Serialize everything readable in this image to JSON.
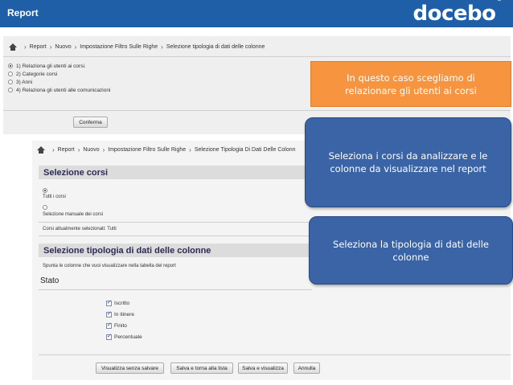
{
  "header": {
    "title": "Report",
    "logo": "docebo",
    "logo_mark": "®"
  },
  "breadcrumb1": {
    "home_icon": "home-icon",
    "items": [
      "Report",
      "Nuovo",
      "Impostazione Filtro Sulle Righe",
      "Selezione tipologia di dati delle colonne"
    ]
  },
  "options": [
    {
      "label": "1) Relaziona gli utenti ai corsi.",
      "selected": true
    },
    {
      "label": "2) Categorie corsi",
      "selected": false
    },
    {
      "label": "3) Anni",
      "selected": false
    },
    {
      "label": "4) Relaziona gli utenti alle comunicazioni",
      "selected": false
    }
  ],
  "confirm_label": "Conferma",
  "breadcrumb2": {
    "items": [
      "Report",
      "Nuovo",
      "Impostazione Filtro Sulle Righe",
      "Selezione Tipologia Di Dati Delle Colonn"
    ]
  },
  "courses_section": {
    "title": "Selezione corsi",
    "opt_all": "Tutti i corsi",
    "opt_manual": "Selezione manuale dei corsi",
    "selected_text": "Corsi attualmente selezionati:  Tutti"
  },
  "columns_section": {
    "title": "Selezione tipologia di dati delle colonne",
    "hint": "Spunta le colonne che vuoi visualizzare nella tabella del report",
    "group_title": "Stato",
    "checkboxes": [
      {
        "label": "Iscritto",
        "checked": true
      },
      {
        "label": "In itinere",
        "checked": true
      },
      {
        "label": "Finito",
        "checked": true
      },
      {
        "label": "Percentuale",
        "checked": true
      }
    ]
  },
  "footer_buttons": [
    "Visualizza senza salvare",
    "Salva e torna alla lista",
    "Salva e visualizza",
    "Annulla"
  ],
  "callouts": [
    {
      "text": "In questo caso scegliamo di relazionare gli utenti ai corsi",
      "color": "#f79440"
    },
    {
      "text": "Seleziona i corsi da analizzare e le colonne da visualizzare nel report",
      "color": "#3a64a6"
    },
    {
      "text": "Seleziona la tipologia di dati delle colonne",
      "color": "#3a64a6"
    }
  ],
  "colors": {
    "header_bg": "#1e5fa8",
    "section_title": "#2b2b55"
  }
}
